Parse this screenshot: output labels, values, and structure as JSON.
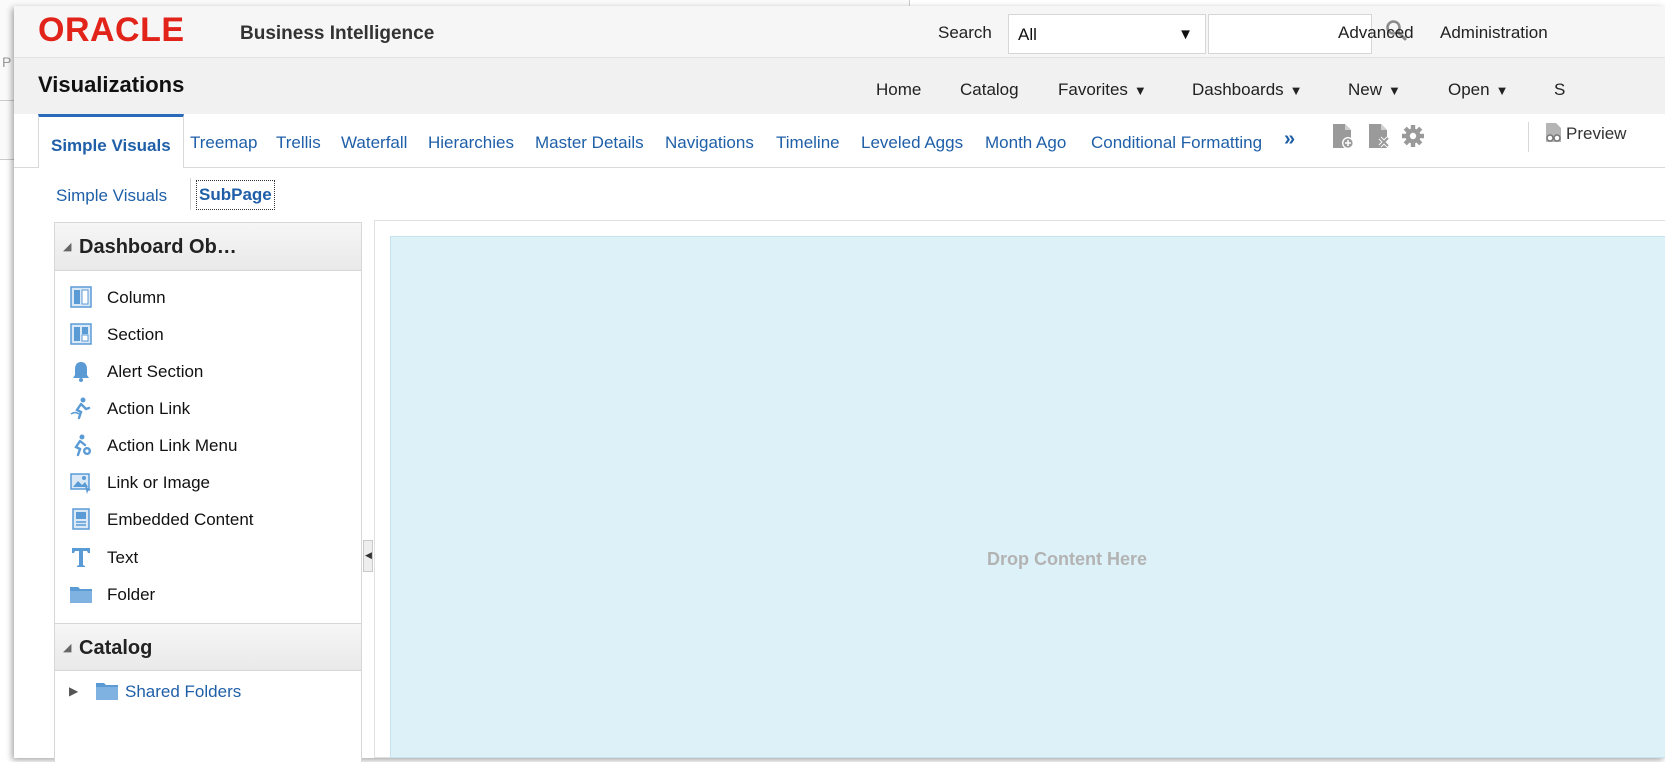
{
  "header": {
    "logo_oracle": "ORACLE",
    "logo_bi": "Business Intelligence",
    "search_label": "Search",
    "search_scope": "All",
    "search_value": "",
    "links": [
      "Advanced",
      "Administration"
    ]
  },
  "titlebar": {
    "title": "Visualizations",
    "nav": [
      {
        "label": "Home",
        "dropdown": false
      },
      {
        "label": "Catalog",
        "dropdown": false
      },
      {
        "label": "Favorites",
        "dropdown": true
      },
      {
        "label": "Dashboards",
        "dropdown": true
      },
      {
        "label": "New",
        "dropdown": true
      },
      {
        "label": "Open",
        "dropdown": true
      }
    ],
    "nav_cut": "S"
  },
  "tabs": {
    "active": "Simple Visuals",
    "items": [
      "Treemap",
      "Trellis",
      "Waterfall",
      "Hierarchies",
      "Master Details",
      "Navigations",
      "Timeline",
      "Leveled Aggs",
      "Month Ago",
      "Conditional Formatting"
    ],
    "more_icon": "double-chevron-right-icon",
    "toolbar": [
      "add-page-icon",
      "delete-page-icon",
      "gear-icon"
    ],
    "preview_label": "Preview"
  },
  "subtabs": {
    "items": [
      "Simple Visuals",
      "SubPage"
    ],
    "selected": "SubPage"
  },
  "left_panel": {
    "dashboard_objects_header": "Dashboard Ob…",
    "objects": [
      {
        "label": "Column",
        "icon": "column-icon"
      },
      {
        "label": "Section",
        "icon": "section-icon"
      },
      {
        "label": "Alert Section",
        "icon": "bell-icon"
      },
      {
        "label": "Action Link",
        "icon": "action-link-icon"
      },
      {
        "label": "Action Link Menu",
        "icon": "action-link-menu-icon"
      },
      {
        "label": "Link or Image",
        "icon": "image-icon"
      },
      {
        "label": "Embedded Content",
        "icon": "embedded-content-icon"
      },
      {
        "label": "Text",
        "icon": "text-icon"
      },
      {
        "label": "Folder",
        "icon": "folder-icon"
      }
    ],
    "catalog_header": "Catalog",
    "catalog_items": [
      {
        "label": "Shared Folders",
        "icon": "folder-icon"
      }
    ]
  },
  "canvas": {
    "drop_label": "Drop Content Here"
  },
  "colors": {
    "oracle_red": "#e2231a",
    "link_blue": "#1f5fa8",
    "dropzone": "#dcf1f8",
    "icon_blue": "#5b9bd5"
  }
}
